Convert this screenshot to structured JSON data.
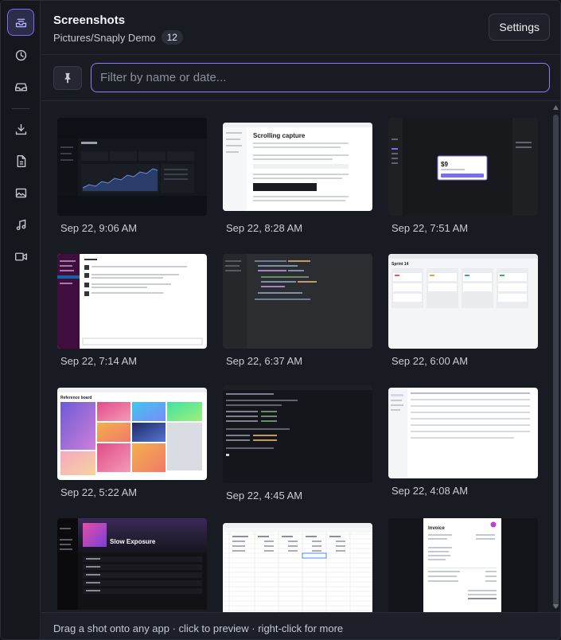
{
  "header": {
    "title": "Screenshots",
    "path": "Pictures/Snaply Demo",
    "count": "12",
    "settings_label": "Settings"
  },
  "filter": {
    "placeholder": "Filter by name or date...",
    "value": ""
  },
  "sidebar": {
    "items": [
      {
        "name": "tray-icon",
        "active": true
      },
      {
        "name": "clock-icon",
        "active": false
      },
      {
        "name": "inbox-icon",
        "active": false
      },
      {
        "name": "download-icon",
        "active": false
      },
      {
        "name": "document-icon",
        "active": false
      },
      {
        "name": "image-icon",
        "active": false
      },
      {
        "name": "music-icon",
        "active": false
      },
      {
        "name": "video-icon",
        "active": false
      }
    ]
  },
  "shots": [
    {
      "caption": "Sep 22, 9:06 AM",
      "kind": "dashboard"
    },
    {
      "caption": "Sep 22, 8:28 AM",
      "kind": "docs"
    },
    {
      "caption": "Sep 22, 7:51 AM",
      "kind": "design"
    },
    {
      "caption": "Sep 22, 7:14 AM",
      "kind": "chat"
    },
    {
      "caption": "Sep 22, 6:37 AM",
      "kind": "code"
    },
    {
      "caption": "Sep 22, 6:00 AM",
      "kind": "kanban"
    },
    {
      "caption": "Sep 22, 5:22 AM",
      "kind": "gallery"
    },
    {
      "caption": "Sep 22, 4:45 AM",
      "kind": "terminal"
    },
    {
      "caption": "Sep 22, 4:08 AM",
      "kind": "mail"
    },
    {
      "caption": "",
      "kind": "music"
    },
    {
      "caption": "",
      "kind": "spreadsheet"
    },
    {
      "caption": "",
      "kind": "invoice"
    }
  ],
  "thumb_text": {
    "docs_heading": "Scrolling capture",
    "price": "$9",
    "board_title": "Sprint 14",
    "gallery_title": "Reference board",
    "album_title": "Slow Exposure",
    "invoice_title": "Invoice"
  },
  "footer": {
    "hint": "Drag a shot onto any app · click to preview · right-click for more"
  },
  "colors": {
    "accent": "#7c6cf0",
    "background": "#181b22"
  }
}
